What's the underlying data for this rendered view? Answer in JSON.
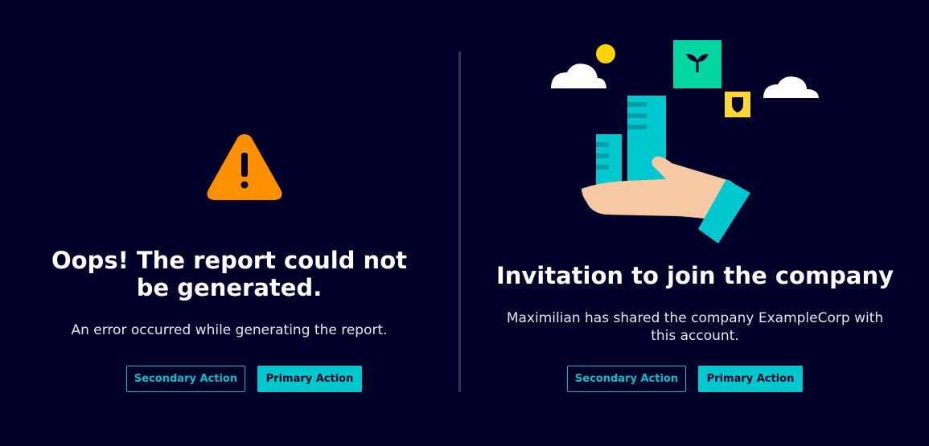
{
  "left": {
    "title": "Oops! The report could not be generated.",
    "description": "An error occurred while generating the report.",
    "secondary_label": "Secondary Action",
    "primary_label": "Primary Action",
    "icon": "warning-icon"
  },
  "right": {
    "title": "Invitation to join the company",
    "description": "Maximilian has shared the company ExampleCorp with this account.",
    "secondary_label": "Secondary Action",
    "primary_label": "Primary Action",
    "illustration": "hand-holding-buildings-illustration"
  },
  "colors": {
    "background": "#000028",
    "accent": "#00c8ce",
    "warning": "#ff9000",
    "divider": "#2f3447"
  }
}
